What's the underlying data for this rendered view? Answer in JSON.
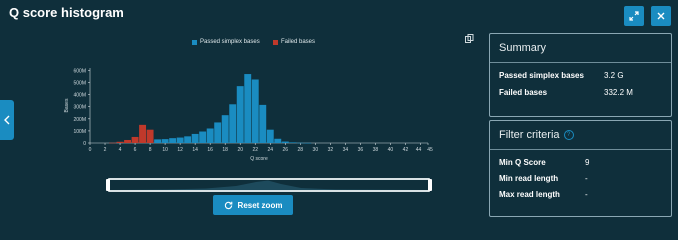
{
  "title": "Q score histogram",
  "header_buttons": {
    "expand_icon": "expand-icon",
    "close_icon": "close-icon"
  },
  "reset_label": "Reset zoom",
  "summary": {
    "heading": "Summary",
    "rows": [
      {
        "label": "Passed simplex bases",
        "value": "3.2 G"
      },
      {
        "label": "Failed bases",
        "value": "332.2 M"
      }
    ]
  },
  "filter": {
    "heading": "Filter criteria",
    "rows": [
      {
        "label": "Min Q Score",
        "value": "9"
      },
      {
        "label": "Min read length",
        "value": "-"
      },
      {
        "label": "Max read length",
        "value": "-"
      }
    ]
  },
  "colors": {
    "passed": "#1a8cc1",
    "failed": "#c0392b",
    "accent": "#1a8cc1",
    "background": "#0f2f3b"
  },
  "chart_data": {
    "type": "bar",
    "xlabel": "Q score",
    "ylabel": "Bases",
    "x_ticks": [
      "0",
      "2",
      "4",
      "6",
      "8",
      "10",
      "12",
      "14",
      "16",
      "18",
      "20",
      "22",
      "24",
      "26",
      "28",
      "30",
      "32",
      "34",
      "36",
      "38",
      "40",
      "42",
      "44",
      "45"
    ],
    "y_ticks": [
      "0",
      "100M",
      "200M",
      "300M",
      "400M",
      "500M",
      "600M"
    ],
    "ylim": [
      0,
      620
    ],
    "xlim": [
      0,
      45
    ],
    "series": [
      {
        "name": "Passed simplex bases",
        "color": "#1a8cc1",
        "x": [
          9,
          10,
          11,
          12,
          13,
          14,
          15,
          16,
          17,
          18,
          19,
          20,
          21,
          22,
          23,
          24,
          25,
          26,
          27,
          28,
          29
        ],
        "values": [
          30,
          32,
          40,
          45,
          55,
          75,
          95,
          120,
          170,
          230,
          320,
          470,
          570,
          525,
          315,
          110,
          35,
          12,
          5,
          2,
          1
        ]
      },
      {
        "name": "Failed bases",
        "color": "#c0392b",
        "x": [
          3,
          4,
          5,
          6,
          7,
          8
        ],
        "values": [
          2,
          10,
          25,
          50,
          150,
          110
        ]
      }
    ]
  }
}
